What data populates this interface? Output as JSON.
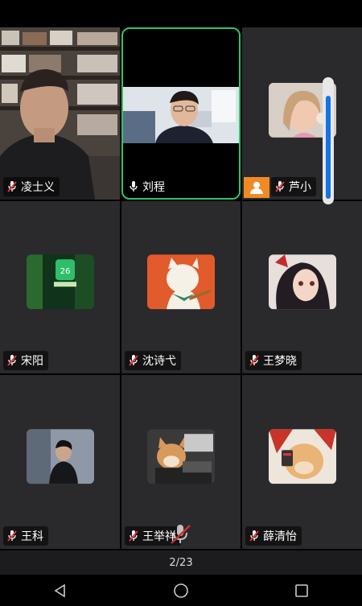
{
  "participants": [
    {
      "name": "凌士义",
      "mic": "muted"
    },
    {
      "name": "刘程",
      "mic": "on"
    },
    {
      "name": "芦小",
      "mic": "muted",
      "host": true
    },
    {
      "name": "宋阳",
      "mic": "muted"
    },
    {
      "name": "沈诗弋",
      "mic": "muted"
    },
    {
      "name": "王梦晓",
      "mic": "muted"
    },
    {
      "name": "王科",
      "mic": "muted"
    },
    {
      "name": "王举祥",
      "mic": "muted"
    },
    {
      "name": "薛清怡",
      "mic": "muted"
    }
  ],
  "pager": {
    "text": "2/23"
  },
  "nav": {
    "icons": [
      "back-triangle-icon",
      "home-circle-icon",
      "recents-square-icon"
    ]
  },
  "colors": {
    "active_border": "#2fc46a",
    "host_badge": "#f08a24",
    "scroll_thumb": "#1473e6"
  }
}
